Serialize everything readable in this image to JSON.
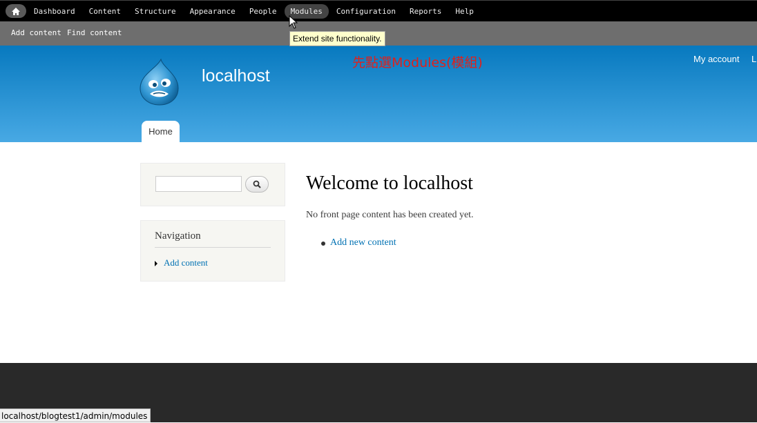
{
  "toolbar": {
    "home_icon": "home-icon",
    "items": [
      "Dashboard",
      "Content",
      "Structure",
      "Appearance",
      "People",
      "Modules",
      "Configuration",
      "Reports",
      "Help"
    ],
    "active": "Modules"
  },
  "shortcuts": {
    "add_content": "Add content",
    "find_content": "Find content"
  },
  "tooltip": "Extend site functionality.",
  "header": {
    "site_name": "localhost",
    "annotation": "先點選Modules(模組)",
    "my_account": "My account",
    "logout": "L",
    "home_tab": "Home"
  },
  "sidebar": {
    "navigation_title": "Navigation",
    "nav_add_content": "Add content"
  },
  "main": {
    "title": "Welcome to localhost",
    "message": "No front page content has been created yet.",
    "add_new": "Add new content"
  },
  "statusbar": "localhost/blogtest1/admin/modules",
  "colors": {
    "header_top": "#0779bf",
    "header_bottom": "#48a9e4",
    "link": "#0071b3",
    "annotation": "#e0201b"
  }
}
